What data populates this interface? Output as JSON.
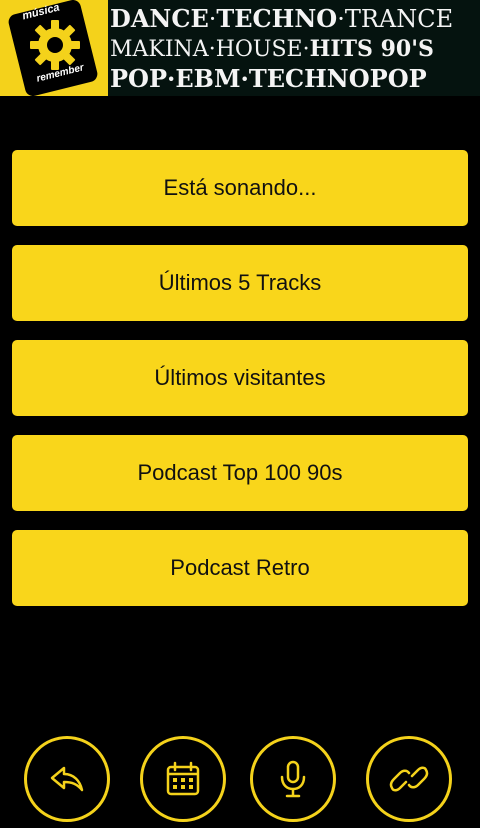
{
  "header": {
    "logo": {
      "top_text": "música",
      "bottom_text": "remember"
    },
    "banner": {
      "line1": {
        "a": "DANCE",
        "sep1": "·",
        "b": "TECHNO",
        "sep2": "·",
        "c": "TRANCE"
      },
      "line2": {
        "a": "MAKINA",
        "sep1": "·",
        "b": "HOUSE",
        "sep2": "·",
        "c": "HITS 90'S"
      },
      "line3": {
        "a": "POP",
        "sep1": "·",
        "b": "EBM",
        "sep2": "·",
        "c": "TECHNOPOP"
      }
    }
  },
  "menu": {
    "items": [
      {
        "label": "Está sonando..."
      },
      {
        "label": "Últimos 5 Tracks"
      },
      {
        "label": "Últimos visitantes"
      },
      {
        "label": "Podcast Top 100 90s"
      },
      {
        "label": "Podcast Retro"
      }
    ]
  },
  "bottom_bar": {
    "icons": [
      "share-icon",
      "calendar-icon",
      "microphone-icon",
      "link-icon"
    ]
  },
  "colors": {
    "accent": "#f9d61b",
    "background": "#000000",
    "text": "#111111"
  }
}
